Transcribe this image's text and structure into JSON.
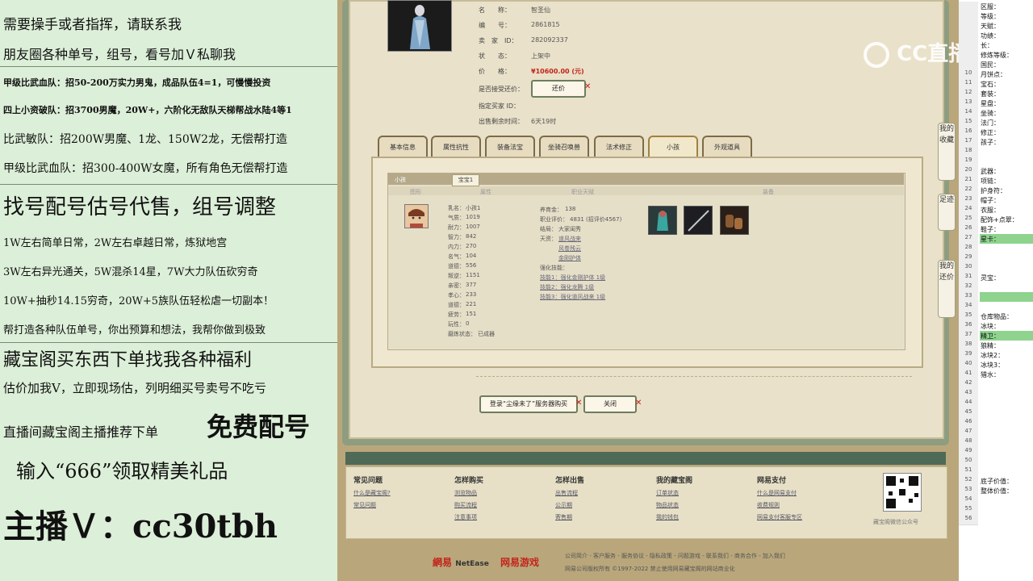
{
  "left_panel": {
    "lines": [
      "需要操手或者指挥，请联系我",
      "朋友圈各种单号，组号，看号加Ｖ私聊我",
      "甲级比武血队：招50-200万实力男鬼，成品队伍4=1，可慢慢投资",
      "四上小资破队：招3700男魔，20W+，六阶化无敌队天梯帮战水陆4等1",
      "比武敏队：招200W男魔、1龙、150W2龙，无偿帮打造",
      "甲级比武血队：招300-400W女魔，所有角色无偿帮打造",
      "找号配号估号代售，组号调整",
      "1W左右简单日常，2W左右卓越日常，炼狱地宫",
      "3W左右异光通关，5W混杀14星，7W大力队伍砍穷奇",
      "10W+抽秒14.15穷奇，20W+5族队伍轻松虐一切副本！",
      "帮打造各种队伍单号，你出预算和想法，我帮你做到极致",
      "藏宝阁买东西下单找我各种福利",
      "估价加我V，立即现场估，列明细买号卖号不吃亏",
      "直播间藏宝阁主播推荐下单",
      "免费配号",
      "输入“666”领取精美礼品",
      "主播Ｖ：cc30tbh"
    ]
  },
  "item": {
    "name_label": "名　　称：",
    "name": "智圣仙",
    "id_label": "编　　号：",
    "id": "2861815",
    "seller_label": "卖　家　ID：",
    "seller": "282092337",
    "status_label": "状　　态：",
    "status": "上架中",
    "price_label": "价　　格：",
    "price": "¥10600.00 (元)",
    "bargain_label": "是否接受还价：",
    "bargain_button": "还价",
    "buyer_label": "指定买家 ID：",
    "time_label": "出售剩余时间：",
    "time": "6天19时"
  },
  "tabs": [
    "基本信息",
    "属性抗性",
    "装备法宝",
    "坐骑召唤兽",
    "法术修正",
    "小孩",
    "外观道具"
  ],
  "active_tab": "小孩",
  "child": {
    "header": "小孩",
    "subtab": "宝宝1",
    "col_headers": [
      "图形",
      "属性",
      "职业天赋",
      "装备"
    ],
    "stats": [
      [
        "乳名：",
        "小孩1"
      ],
      [
        "气质：",
        "1019"
      ],
      [
        "耐力：",
        "1007"
      ],
      [
        "智力：",
        "842"
      ],
      [
        "内力：",
        "270"
      ],
      [
        "名气：",
        "104"
      ],
      [
        "道德：",
        "556"
      ],
      [
        "叛逆：",
        "1151"
      ],
      [
        "亲密：",
        "377"
      ],
      [
        "孝心：",
        "233"
      ],
      [
        "道德：",
        "221"
      ],
      [
        "疲劳：",
        "151"
      ],
      [
        "玩性：",
        "0"
      ],
      [
        "磨炼状态：",
        "已成器"
      ]
    ],
    "career": {
      "money_label": "养育金：",
      "money": "138",
      "eval_label": "职业评价：",
      "eval": "4831 (招评价4567)",
      "result_label": "结局：",
      "result": "大家闺秀",
      "talent_label": "天资：",
      "talents": [
        "道风战来",
        "风卷残云",
        "金刚护体"
      ],
      "skill_label": "强化技能：",
      "skills": [
        "技能1：强化金刚护体 1级",
        "技能2：强化龙腾 1级",
        "技能3：强化道风战来 1级"
      ]
    }
  },
  "buttons": {
    "login": "登录“尘缘未了”服务器购买",
    "close": "关闭"
  },
  "footer": {
    "columns": [
      {
        "title": "常见问题",
        "links": [
          "什么是藏宝阁?",
          "常见问题"
        ]
      },
      {
        "title": "怎样购买",
        "links": [
          "浏览物品",
          "购买流程",
          "注意事项"
        ]
      },
      {
        "title": "怎样出售",
        "links": [
          "出售流程",
          "公示期",
          "寄售期"
        ]
      },
      {
        "title": "我的藏宝阁",
        "links": [
          "订单状态",
          "物品状态",
          "我的钱包"
        ]
      },
      {
        "title": "网易支付",
        "links": [
          "什么是网易支付",
          "收费规则",
          "网易支付客服专区"
        ]
      }
    ],
    "qr_caption": "藏宝阁微信公众号",
    "bottom_links": "公司简介 - 客户服务 - 服务协议 - 隐私政策 - 问题游戏 - 联系我们 - 商务合作 - 加入我们",
    "copyright": "网易公司版权所有 ©1997-2022 禁止使用网易藏宝阁的网站商业化",
    "netease": "NetEase",
    "netease_cn": "網易",
    "games": "网易游戏"
  },
  "side_tabs": [
    "我的收藏",
    "足迹",
    "我的还价"
  ],
  "watermark": "CC直播",
  "sheet": {
    "rows": [
      [
        "",
        "区服："
      ],
      [
        "",
        "等级："
      ],
      [
        "",
        "天赋："
      ],
      [
        "",
        "功绩："
      ],
      [
        "",
        "长："
      ],
      [
        "",
        "修炼等级："
      ],
      [
        "",
        "国民："
      ],
      [
        "10",
        "月饼点："
      ],
      [
        "11",
        "宝石："
      ],
      [
        "12",
        "套装："
      ],
      [
        "13",
        "星盘："
      ],
      [
        "14",
        "坐骑："
      ],
      [
        "15",
        "法门："
      ],
      [
        "16",
        "修正："
      ],
      [
        "17",
        "孩子："
      ],
      [
        "18",
        ""
      ],
      [
        "19",
        ""
      ],
      [
        "20",
        "武器："
      ],
      [
        "21",
        "项链："
      ],
      [
        "22",
        "护身符："
      ],
      [
        "23",
        "帽子："
      ],
      [
        "24",
        "衣服："
      ],
      [
        "25",
        "配饰+点翠："
      ],
      [
        "26",
        "鞋子："
      ],
      [
        "27",
        "星卡："
      ],
      [
        "28",
        ""
      ],
      [
        "29",
        ""
      ],
      [
        "30",
        ""
      ],
      [
        "31",
        "灵宝："
      ],
      [
        "32",
        ""
      ],
      [
        "33",
        ""
      ],
      [
        "34",
        ""
      ],
      [
        "35",
        "仓库物品："
      ],
      [
        "36",
        "冰块："
      ],
      [
        "37",
        "精卫："
      ],
      [
        "38",
        "狼精："
      ],
      [
        "39",
        "冰块2："
      ],
      [
        "40",
        "冰块3："
      ],
      [
        "41",
        "猎水："
      ],
      [
        "42",
        ""
      ],
      [
        "43",
        ""
      ],
      [
        "44",
        ""
      ],
      [
        "45",
        ""
      ],
      [
        "46",
        ""
      ],
      [
        "47",
        ""
      ],
      [
        "48",
        ""
      ],
      [
        "49",
        ""
      ],
      [
        "50",
        ""
      ],
      [
        "51",
        ""
      ],
      [
        "52",
        "底子价值："
      ],
      [
        "53",
        "整体价值："
      ],
      [
        "54",
        ""
      ],
      [
        "55",
        ""
      ],
      [
        "56",
        ""
      ]
    ],
    "highlight_rows": [
      24,
      30,
      34
    ]
  }
}
